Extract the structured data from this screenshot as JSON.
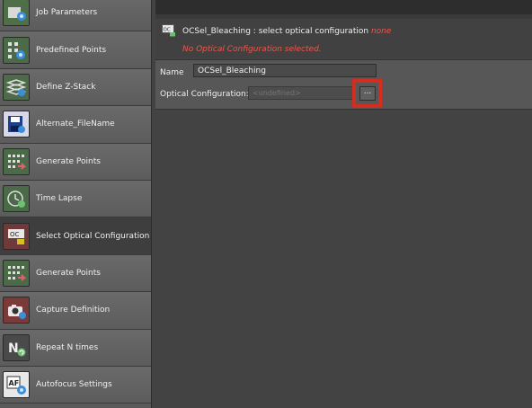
{
  "sidebar": {
    "items": [
      {
        "label": "Job Parameters",
        "icon": "job-parameters-icon",
        "selected": false
      },
      {
        "label": "Predefined Points",
        "icon": "predefined-points-icon",
        "selected": false
      },
      {
        "label": "Define Z-Stack",
        "icon": "z-stack-icon",
        "selected": false
      },
      {
        "label": "Alternate_FileName",
        "icon": "alternate-filename-icon",
        "selected": false
      },
      {
        "label": "Generate Points",
        "icon": "generate-points-icon",
        "selected": false
      },
      {
        "label": "Time Lapse",
        "icon": "time-lapse-icon",
        "selected": false
      },
      {
        "label": "Select Optical Configuration",
        "icon": "optical-configuration-icon",
        "selected": true
      },
      {
        "label": "Generate Points",
        "icon": "generate-points-icon",
        "selected": false
      },
      {
        "label": "Capture Definition",
        "icon": "capture-definition-icon",
        "selected": false
      },
      {
        "label": "Repeat N times",
        "icon": "repeat-icon",
        "selected": false
      },
      {
        "label": "Autofocus Settings",
        "icon": "autofocus-icon",
        "selected": false
      }
    ]
  },
  "panel": {
    "name": "OCSel_Bleaching",
    "separator": " : ",
    "description": "select optical configuration",
    "value": "none",
    "error": "No Optical Configuration selected."
  },
  "form": {
    "name_label": "Name",
    "name_value": "OCSel_Bleaching",
    "oc_label": "Optical Configuration:",
    "oc_placeholder": "<undefined>",
    "browse_label": "..."
  },
  "colors": {
    "error": "#e8584f",
    "highlight": "#d62b1f"
  }
}
